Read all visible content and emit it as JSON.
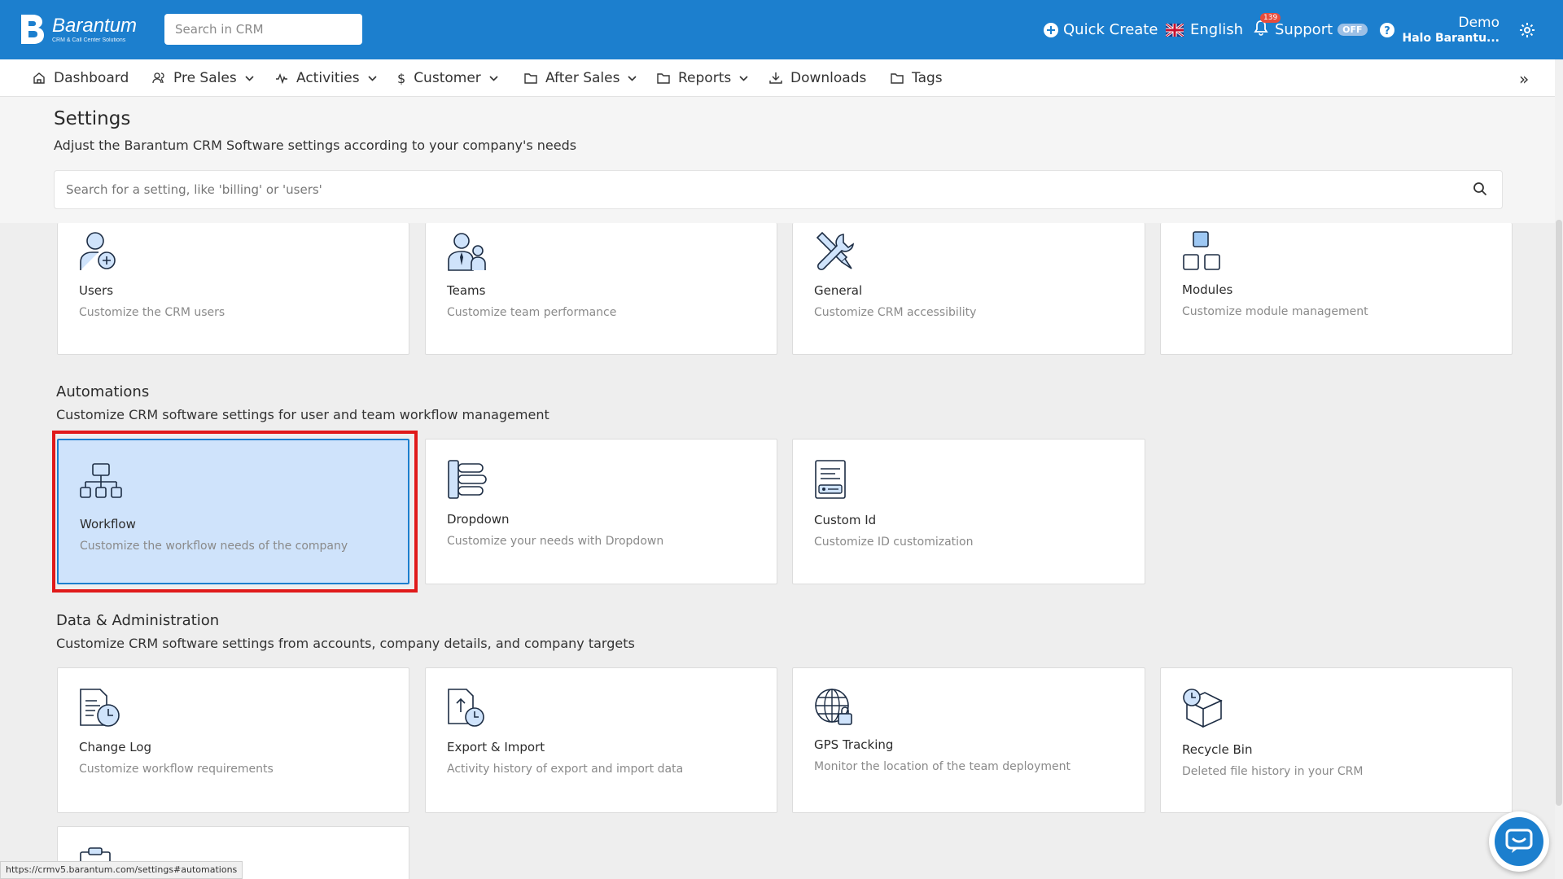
{
  "brand": {
    "name": "Barantum",
    "tagline": "CRM & Call Center Solutions"
  },
  "topbar": {
    "search_placeholder": "Search in CRM",
    "quick_create": "Quick Create",
    "language": "English",
    "notification_count": "139",
    "support": "Support",
    "support_state": "OFF",
    "user_name": "Demo",
    "user_company": "Halo Barantu..."
  },
  "nav": {
    "items": [
      {
        "label": "Dashboard",
        "icon": "home-icon",
        "dropdown": false
      },
      {
        "label": "Pre Sales",
        "icon": "users-icon",
        "dropdown": true
      },
      {
        "label": "Activities",
        "icon": "activity-icon",
        "dropdown": true
      },
      {
        "label": "Customer",
        "icon": "dollar-icon",
        "dropdown": true
      },
      {
        "label": "After Sales",
        "icon": "folder-icon",
        "dropdown": true
      },
      {
        "label": "Reports",
        "icon": "folder-icon",
        "dropdown": true
      },
      {
        "label": "Downloads",
        "icon": "download-icon",
        "dropdown": false
      },
      {
        "label": "Tags",
        "icon": "folder-icon",
        "dropdown": false
      }
    ],
    "more": "»"
  },
  "settings": {
    "title": "Settings",
    "subtitle": "Adjust the Barantum CRM Software settings according to your company's needs",
    "search_placeholder": "Search for a setting, like 'billing' or 'users'"
  },
  "top_cards": [
    {
      "title": "Users",
      "desc": "Customize the CRM users",
      "icon": "user-add-icon"
    },
    {
      "title": "Teams",
      "desc": "Customize team performance",
      "icon": "team-icon"
    },
    {
      "title": "General",
      "desc": "Customize CRM accessibility",
      "icon": "tools-icon"
    },
    {
      "title": "Modules",
      "desc": "Customize module management",
      "icon": "modules-icon"
    }
  ],
  "automations": {
    "title": "Automations",
    "subtitle": "Customize CRM software settings for user and team workflow management",
    "cards": [
      {
        "title": "Workflow",
        "desc": "Customize the workflow needs of the company",
        "icon": "workflow-icon",
        "selected": true
      },
      {
        "title": "Dropdown",
        "desc": "Customize your needs with Dropdown",
        "icon": "dropdown-list-icon"
      },
      {
        "title": "Custom Id",
        "desc": "Customize ID customization",
        "icon": "id-document-icon"
      }
    ]
  },
  "data_admin": {
    "title": "Data & Administration",
    "subtitle": "Customize CRM software settings from accounts, company details, and company targets",
    "cards": [
      {
        "title": "Change Log",
        "desc": "Customize workflow requirements",
        "icon": "change-log-icon"
      },
      {
        "title": "Export & Import",
        "desc": "Activity history of export and import data",
        "icon": "export-import-icon"
      },
      {
        "title": "GPS Tracking",
        "desc": "Monitor the location of the team deployment",
        "icon": "globe-lock-icon"
      },
      {
        "title": "Recycle Bin",
        "desc": "Deleted file history in your CRM",
        "icon": "recycle-box-icon"
      }
    ]
  },
  "status_url": "https://crmv5.barantum.com/settings#automations",
  "colors": {
    "brand": "#1c7fce",
    "selected_card": "#cfe3fb",
    "highlight": "#e01a1a"
  }
}
